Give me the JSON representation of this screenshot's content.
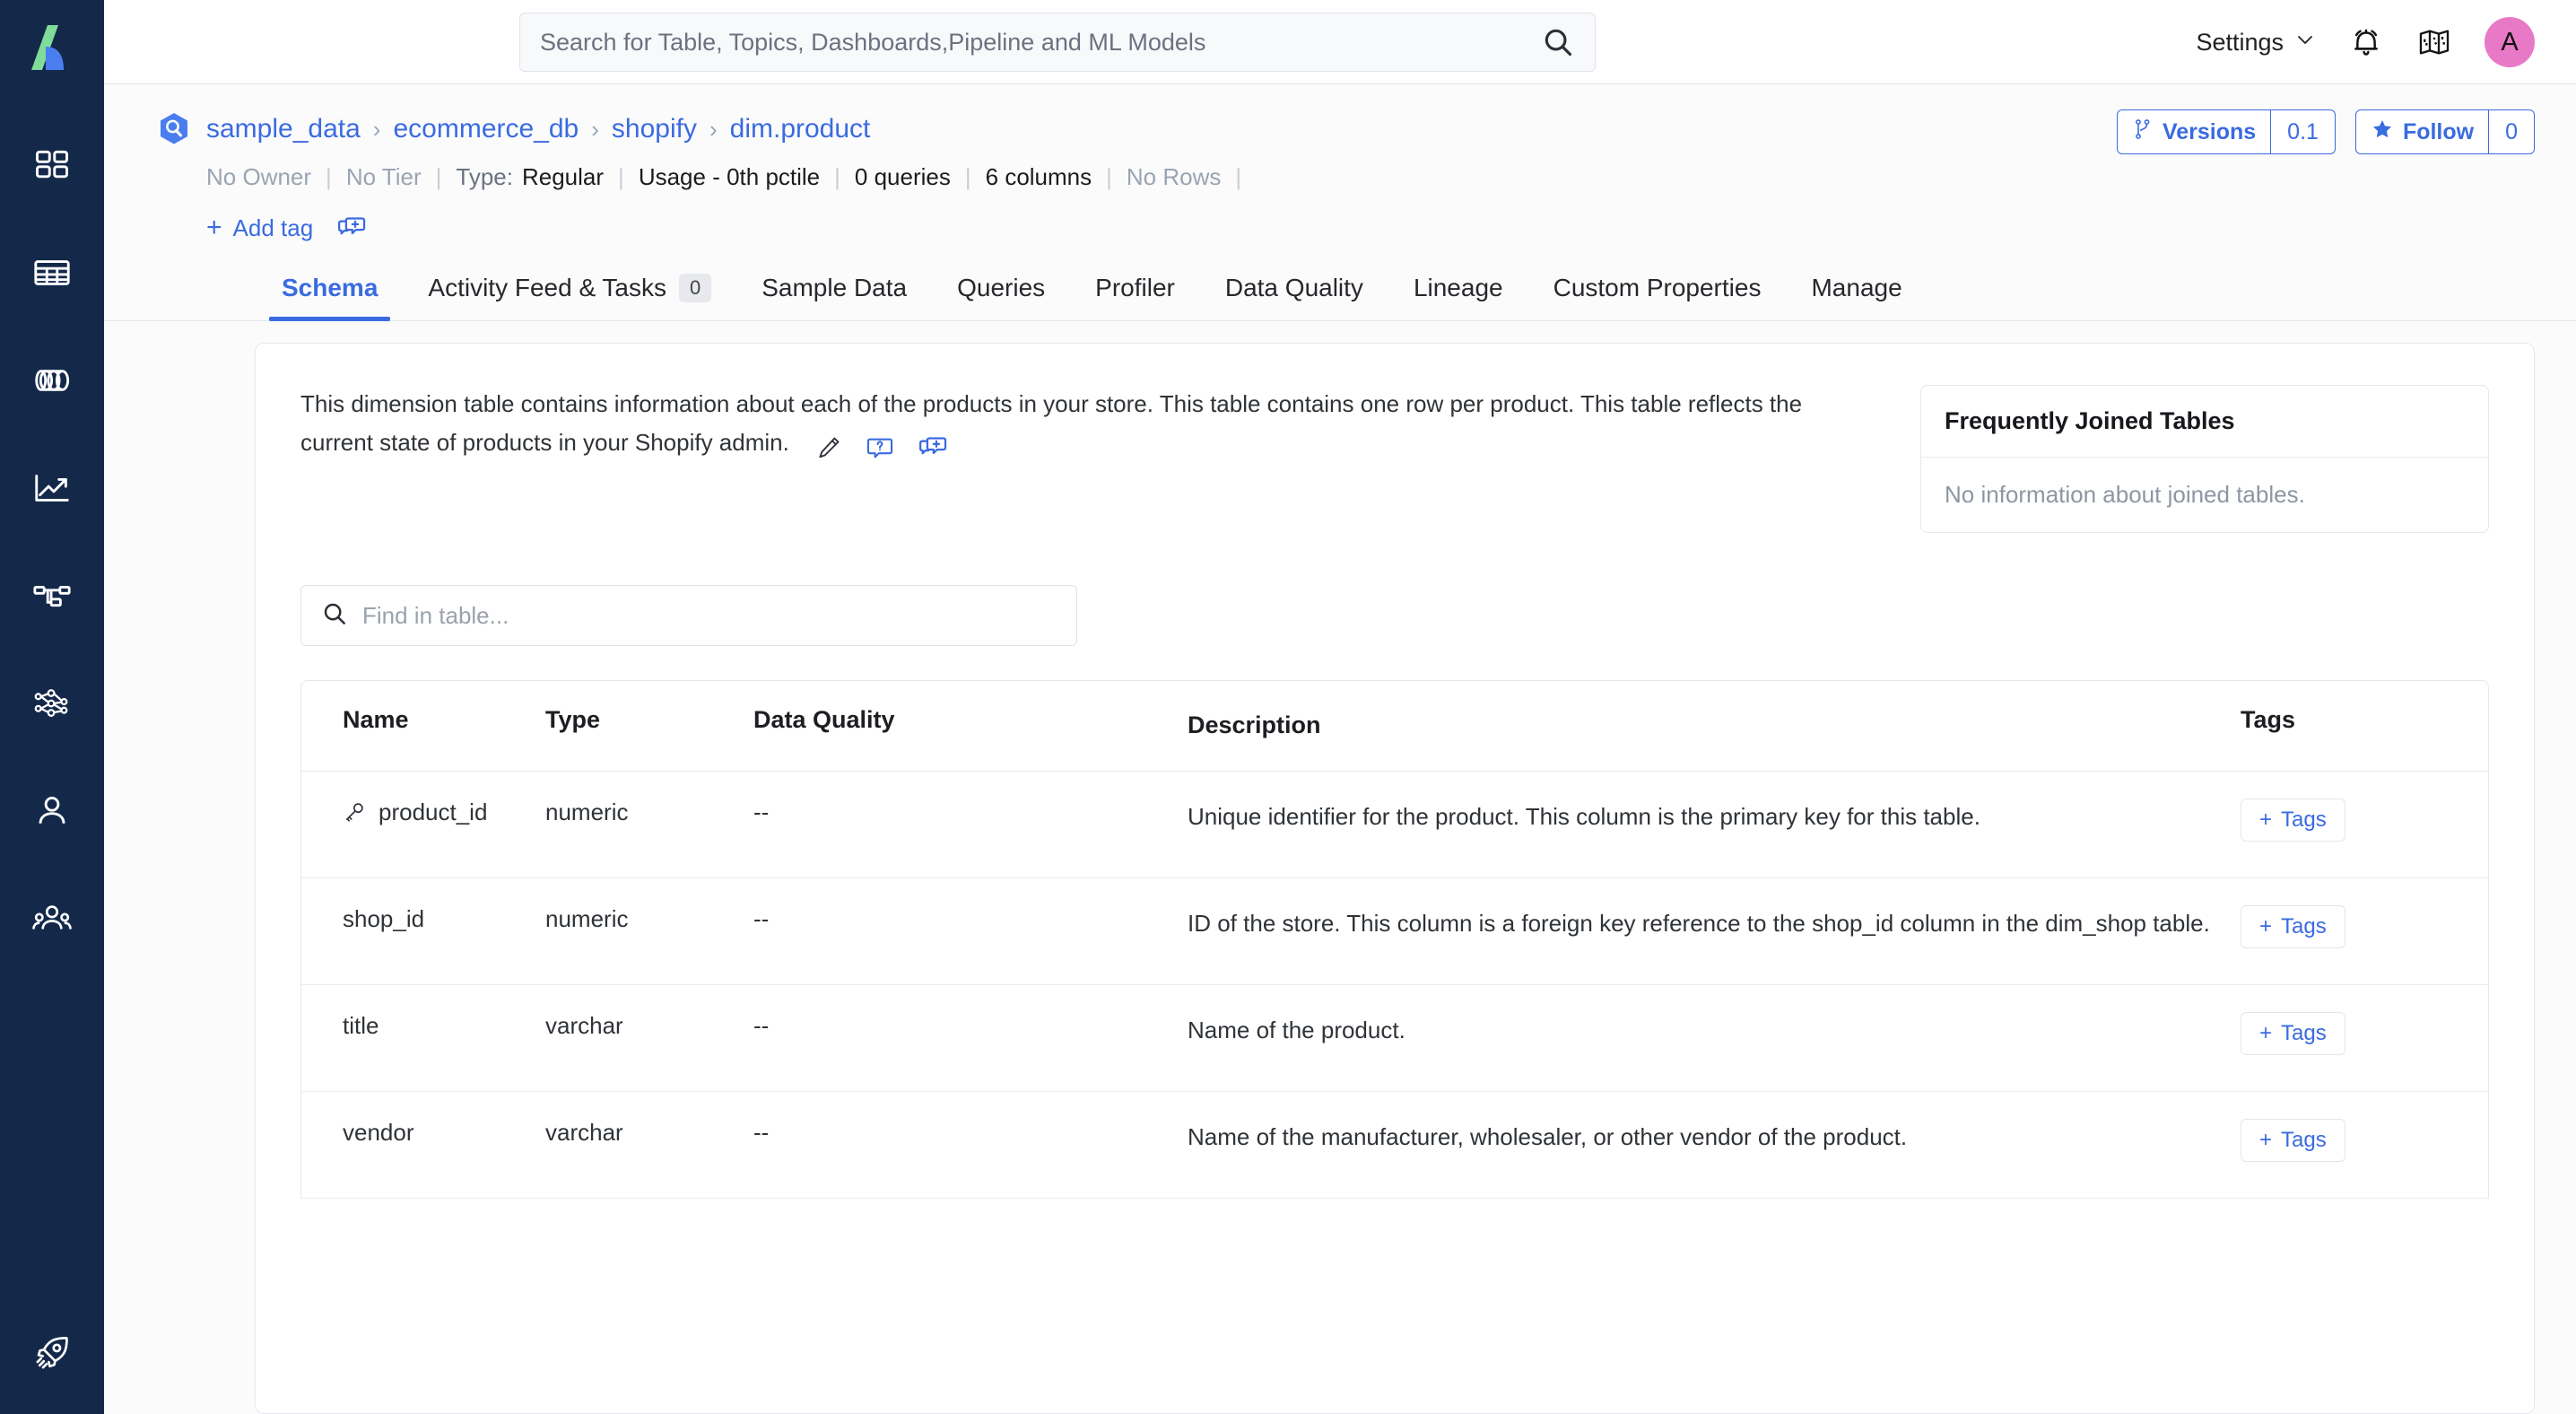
{
  "app": {
    "logo_name": "openmetadata-logo",
    "accent_blue": "#3a6be0",
    "sidebar_bg": "#14294a",
    "avatar_color": "#e879c6"
  },
  "sidebar": {
    "items": [
      {
        "icon": "dashboard-grid-icon",
        "label": "Explore"
      },
      {
        "icon": "table-icon",
        "label": "Tables"
      },
      {
        "icon": "database-icon",
        "label": "Topics"
      },
      {
        "icon": "chart-line-icon",
        "label": "Dashboards"
      },
      {
        "icon": "pipeline-nodes-icon",
        "label": "Pipelines"
      },
      {
        "icon": "ml-model-network-icon",
        "label": "ML Models"
      },
      {
        "icon": "user-icon",
        "label": "Users"
      },
      {
        "icon": "users-group-icon",
        "label": "Teams"
      }
    ],
    "bottom_item": {
      "icon": "rocket-icon",
      "label": "Whats New"
    }
  },
  "topbar": {
    "search": {
      "placeholder": "Search for Table, Topics, Dashboards,Pipeline and ML Models",
      "value": "",
      "icon": "search-icon"
    },
    "settings_label": "Settings",
    "settings_chevron": "chevron-down-icon",
    "bell_icon": "bell-icon",
    "docs_icon": "map-book-icon",
    "avatar_initial": "A"
  },
  "page_header": {
    "breadcrumb": [
      {
        "label": "sample_data"
      },
      {
        "label": "ecommerce_db"
      },
      {
        "label": "shopify"
      },
      {
        "label": "dim.product"
      }
    ],
    "breadcrumb_separator": "›",
    "service_icon": "bigquery-service-icon",
    "meta": {
      "owner": "No Owner",
      "tier": "No Tier",
      "type_label": "Type:",
      "type_value": "Regular",
      "usage": "Usage - 0th pctile",
      "queries": "0 queries",
      "columns": "6 columns",
      "rows": "No Rows",
      "separator": "|"
    },
    "add_tag": {
      "plus": "+",
      "label": "Add tag",
      "comment_icon": "comment-plus-icon"
    },
    "versions_button": {
      "icon": "branch-icon",
      "label": "Versions",
      "count": "0.1"
    },
    "follow_button": {
      "icon": "star-icon",
      "label": "Follow",
      "count": "0"
    }
  },
  "tabs": [
    {
      "label": "Schema",
      "active": true,
      "badge": null
    },
    {
      "label": "Activity Feed & Tasks",
      "active": false,
      "badge": "0"
    },
    {
      "label": "Sample Data",
      "active": false,
      "badge": null
    },
    {
      "label": "Queries",
      "active": false,
      "badge": null
    },
    {
      "label": "Profiler",
      "active": false,
      "badge": null
    },
    {
      "label": "Data Quality",
      "active": false,
      "badge": null
    },
    {
      "label": "Lineage",
      "active": false,
      "badge": null
    },
    {
      "label": "Custom Properties",
      "active": false,
      "badge": null
    },
    {
      "label": "Manage",
      "active": false,
      "badge": null
    }
  ],
  "description": {
    "text": "This dimension table contains information about each of the products in your store. This table contains one row per product. This table reflects the current state of products in your Shopify admin.",
    "icons": [
      "edit-pencil-icon",
      "question-bubble-icon",
      "comment-plus-icon"
    ]
  },
  "joined_tables": {
    "title": "Frequently Joined Tables",
    "empty_message": "No information about joined tables."
  },
  "find_in_table": {
    "placeholder": "Find in table...",
    "value": "",
    "icon": "search-icon"
  },
  "schema_table": {
    "columns": [
      "Name",
      "Type",
      "Data Quality",
      "Description",
      "Tags"
    ],
    "tags_button_label": "Tags",
    "tags_button_plus": "+",
    "rows": [
      {
        "name": "product_id",
        "is_primary_key": true,
        "type": "numeric",
        "data_quality": "--",
        "description": "Unique identifier for the product. This column is the primary key for this table.",
        "tags": []
      },
      {
        "name": "shop_id",
        "is_primary_key": false,
        "type": "numeric",
        "data_quality": "--",
        "description": "ID of the store. This column is a foreign key reference to the shop_id column in the dim_shop table.",
        "tags": []
      },
      {
        "name": "title",
        "is_primary_key": false,
        "type": "varchar",
        "data_quality": "--",
        "description": "Name of the product.",
        "tags": []
      },
      {
        "name": "vendor",
        "is_primary_key": false,
        "type": "varchar",
        "data_quality": "--",
        "description": "Name of the manufacturer, wholesaler, or other vendor of the product.",
        "tags": []
      }
    ]
  }
}
